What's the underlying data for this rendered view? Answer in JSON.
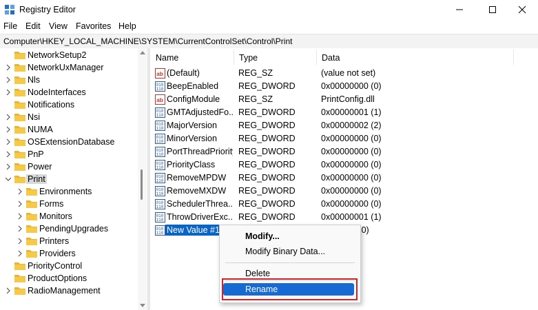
{
  "window": {
    "title": "Registry Editor"
  },
  "menu": [
    "File",
    "Edit",
    "View",
    "Favorites",
    "Help"
  ],
  "address": "Computer\\HKEY_LOCAL_MACHINE\\SYSTEM\\CurrentControlSet\\Control\\Print",
  "tree": {
    "items": [
      {
        "label": "NetworkSetup2",
        "level": 0,
        "expandable": false
      },
      {
        "label": "NetworkUxManager",
        "level": 0,
        "expandable": true
      },
      {
        "label": "Nls",
        "level": 0,
        "expandable": true
      },
      {
        "label": "NodeInterfaces",
        "level": 0,
        "expandable": true
      },
      {
        "label": "Notifications",
        "level": 0,
        "expandable": false
      },
      {
        "label": "Nsi",
        "level": 0,
        "expandable": true
      },
      {
        "label": "NUMA",
        "level": 0,
        "expandable": true
      },
      {
        "label": "OSExtensionDatabase",
        "level": 0,
        "expandable": true
      },
      {
        "label": "PnP",
        "level": 0,
        "expandable": true
      },
      {
        "label": "Power",
        "level": 0,
        "expandable": true
      },
      {
        "label": "Print",
        "level": 0,
        "expandable": true,
        "expanded": true,
        "selected": true
      },
      {
        "label": "Environments",
        "level": 1,
        "expandable": true
      },
      {
        "label": "Forms",
        "level": 1,
        "expandable": true
      },
      {
        "label": "Monitors",
        "level": 1,
        "expandable": true
      },
      {
        "label": "PendingUpgrades",
        "level": 1,
        "expandable": true
      },
      {
        "label": "Printers",
        "level": 1,
        "expandable": true
      },
      {
        "label": "Providers",
        "level": 1,
        "expandable": true
      },
      {
        "label": "PriorityControl",
        "level": 0,
        "expandable": false
      },
      {
        "label": "ProductOptions",
        "level": 0,
        "expandable": false
      },
      {
        "label": "RadioManagement",
        "level": 0,
        "expandable": true
      }
    ]
  },
  "values": {
    "columns": [
      "Name",
      "Type",
      "Data"
    ],
    "rows": [
      {
        "name": "(Default)",
        "type": "REG_SZ",
        "data": "(value not set)",
        "icon": "string"
      },
      {
        "name": "BeepEnabled",
        "type": "REG_DWORD",
        "data": "0x00000000 (0)",
        "icon": "binary"
      },
      {
        "name": "ConfigModule",
        "type": "REG_SZ",
        "data": "PrintConfig.dll",
        "icon": "string"
      },
      {
        "name": "GMTAdjustedFo...",
        "type": "REG_DWORD",
        "data": "0x00000001 (1)",
        "icon": "binary"
      },
      {
        "name": "MajorVersion",
        "type": "REG_DWORD",
        "data": "0x00000002 (2)",
        "icon": "binary"
      },
      {
        "name": "MinorVersion",
        "type": "REG_DWORD",
        "data": "0x00000000 (0)",
        "icon": "binary"
      },
      {
        "name": "PortThreadPriority",
        "type": "REG_DWORD",
        "data": "0x00000000 (0)",
        "icon": "binary"
      },
      {
        "name": "PriorityClass",
        "type": "REG_DWORD",
        "data": "0x00000000 (0)",
        "icon": "binary"
      },
      {
        "name": "RemoveMPDW",
        "type": "REG_DWORD",
        "data": "0x00000000 (0)",
        "icon": "binary"
      },
      {
        "name": "RemoveMXDW",
        "type": "REG_DWORD",
        "data": "0x00000000 (0)",
        "icon": "binary"
      },
      {
        "name": "SchedulerThrea...",
        "type": "REG_DWORD",
        "data": "0x00000000 (0)",
        "icon": "binary"
      },
      {
        "name": "ThrowDriverExc...",
        "type": "REG_DWORD",
        "data": "0x00000001 (1)",
        "icon": "binary"
      },
      {
        "name": "New Value #1",
        "type": "",
        "data": "0 (0)",
        "icon": "binary",
        "editing": true
      }
    ]
  },
  "context_menu": {
    "items": [
      {
        "label": "Modify...",
        "bold": true
      },
      {
        "label": "Modify Binary Data..."
      },
      {
        "separator": true
      },
      {
        "label": "Delete"
      },
      {
        "separator": true
      },
      {
        "label": "Rename",
        "highlighted": true
      }
    ]
  },
  "colors": {
    "selection": "#0a64c8",
    "menu_highlight": "#1769d4",
    "callout_border": "#d32029",
    "folder": "#f7c948"
  }
}
